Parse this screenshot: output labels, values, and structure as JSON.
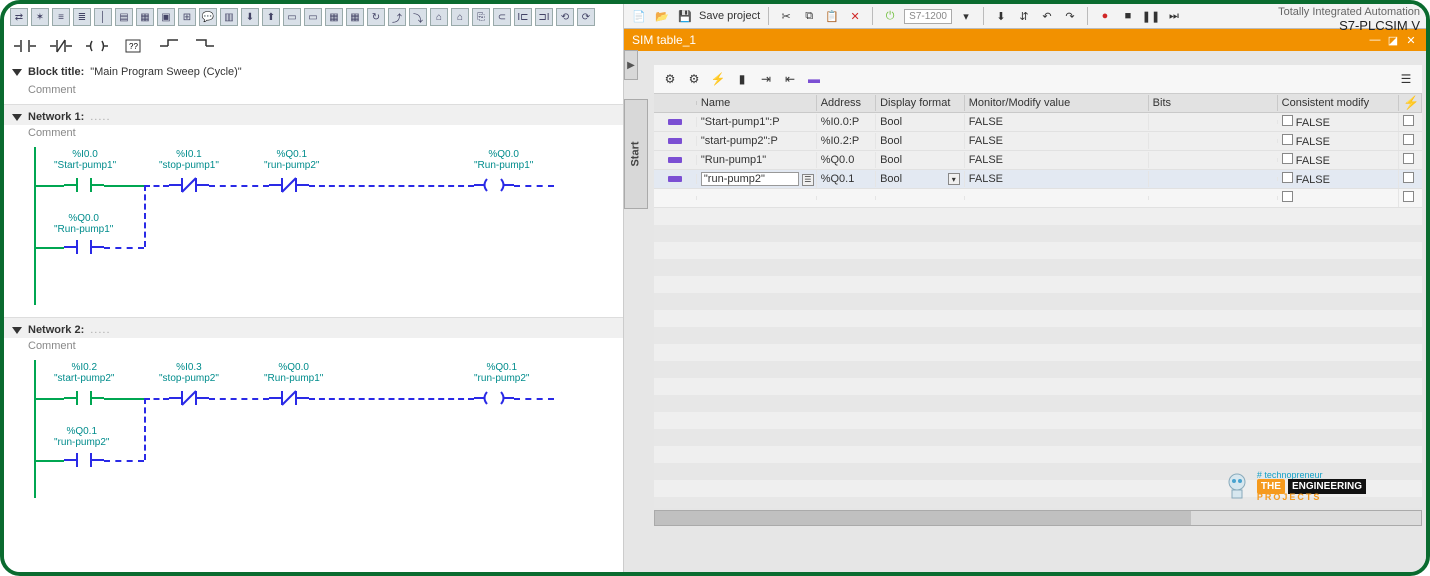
{
  "app": {
    "branding_line1": "Totally Integrated Automation",
    "branding_line2": "S7-PLCSIM V",
    "save_label": "Save project",
    "device_select": "S7-1200"
  },
  "sim_tab": {
    "title": "SIM table_1"
  },
  "left": {
    "block_title_label": "Block title:",
    "block_title_value": "\"Main Program Sweep (Cycle)\"",
    "comment_label": "Comment",
    "networks": [
      {
        "title": "Network 1:",
        "elements": [
          {
            "addr": "%I0.0",
            "name": "\"Start-pump1\""
          },
          {
            "addr": "%I0.1",
            "name": "\"stop-pump1\""
          },
          {
            "addr": "%Q0.1",
            "name": "\"run-pump2\""
          },
          {
            "addr": "%Q0.0",
            "name": "\"Run-pump1\""
          },
          {
            "addr": "%Q0.0",
            "name": "\"Run-pump1\""
          }
        ]
      },
      {
        "title": "Network 2:",
        "elements": [
          {
            "addr": "%I0.2",
            "name": "\"start-pump2\""
          },
          {
            "addr": "%I0.3",
            "name": "\"stop-pump2\""
          },
          {
            "addr": "%Q0.0",
            "name": "\"Run-pump1\""
          },
          {
            "addr": "%Q0.1",
            "name": "\"run-pump2\""
          },
          {
            "addr": "%Q0.1",
            "name": "\"run-pump2\""
          }
        ]
      }
    ]
  },
  "sim_table": {
    "side_label": "Start",
    "headers": {
      "name": "Name",
      "address": "Address",
      "format": "Display format",
      "monitor": "Monitor/Modify value",
      "bits": "Bits",
      "consistent": "Consistent modify"
    },
    "rows": [
      {
        "name": "\"Start-pump1\":P",
        "address": "%I0.0:P",
        "format": "Bool",
        "monitor": "FALSE",
        "consistent": "FALSE",
        "selected": false
      },
      {
        "name": "\"start-pump2\":P",
        "address": "%I0.2:P",
        "format": "Bool",
        "monitor": "FALSE",
        "consistent": "FALSE",
        "selected": false
      },
      {
        "name": "\"Run-pump1\"",
        "address": "%Q0.0",
        "format": "Bool",
        "monitor": "FALSE",
        "consistent": "FALSE",
        "selected": false
      },
      {
        "name": "\"run-pump2\"",
        "address": "%Q0.1",
        "format": "Bool",
        "monitor": "FALSE",
        "consistent": "FALSE",
        "selected": true
      }
    ]
  },
  "watermark": {
    "tag": "# technopreneur",
    "the": "THE",
    "eng": "ENGINEERING",
    "proj": "PROJECTS"
  }
}
